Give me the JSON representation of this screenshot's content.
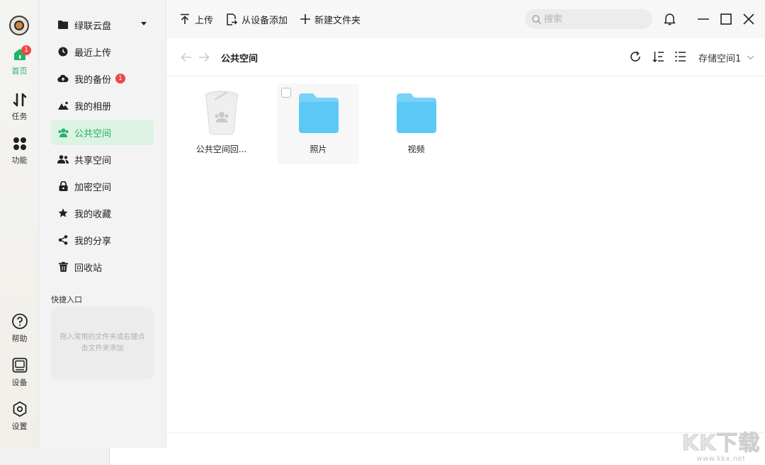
{
  "rail": {
    "home": {
      "label": "首页",
      "badge": "1"
    },
    "tasks": {
      "label": "任务"
    },
    "features": {
      "label": "功能"
    },
    "help": {
      "label": "帮助"
    },
    "device": {
      "label": "设备"
    },
    "settings": {
      "label": "设置"
    }
  },
  "sidebar": {
    "items": [
      {
        "label": "绿联云盘"
      },
      {
        "label": "最近上传"
      },
      {
        "label": "我的备份",
        "badge": "1"
      },
      {
        "label": "我的相册"
      },
      {
        "label": "公共空间"
      },
      {
        "label": "共享空间"
      },
      {
        "label": "加密空间"
      },
      {
        "label": "我的收藏"
      },
      {
        "label": "我的分享"
      },
      {
        "label": "回收站"
      }
    ],
    "quick_title": "快捷入口",
    "quick_hint": "拖入常用的文件夹或右键点击文件夹添加"
  },
  "toolbar": {
    "upload_label": "上传",
    "add_from_device_label": "从设备添加",
    "new_folder_label": "新建文件夹",
    "search_placeholder": "搜索"
  },
  "path": {
    "title": "公共空间",
    "storage_label": "存储空间1"
  },
  "files": [
    {
      "name": "公共空间回...",
      "type": "recycle-bin"
    },
    {
      "name": "照片",
      "type": "folder"
    },
    {
      "name": "视频",
      "type": "folder"
    }
  ],
  "watermark": {
    "big": "KK下载",
    "small": "www.kkx.net"
  },
  "colors": {
    "accent": "#22b36a",
    "folder": "#5bc8f5",
    "badge": "#f04646"
  }
}
